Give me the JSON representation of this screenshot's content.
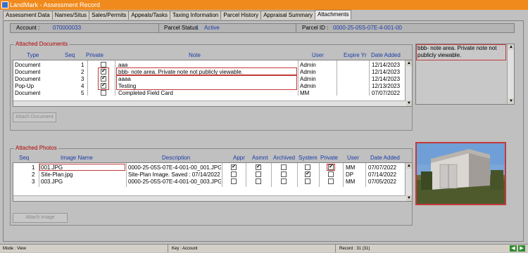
{
  "window": {
    "title": "LandMark - Assessment Record"
  },
  "tabs": [
    "Assessment Data",
    "Names/Situs",
    "Sales/Permits",
    "Appeals/Tasks",
    "Taxing Information",
    "Parcel History",
    "Appraisal Summary",
    "Attachments"
  ],
  "info": {
    "account_label": "Account :",
    "account_value": "070000033",
    "status_label": "Parcel Status",
    "status_num": "1",
    "status_value": "Active",
    "parcel_label": "Parcel ID :",
    "parcel_value": "0000-25-05S-07E-4-001-00"
  },
  "documents": {
    "title": "Attached Documents",
    "headers": {
      "type": "Type",
      "seq": "Seq",
      "private": "Private",
      "note": "Note",
      "user": "User",
      "expire": "Expire Yr",
      "date": "Date Added"
    },
    "rows": [
      {
        "type": "Document",
        "seq": "1",
        "private": false,
        "note": "aaa",
        "user": "Admin",
        "expire": "",
        "date": "12/14/2023"
      },
      {
        "type": "Document",
        "seq": "2",
        "private": true,
        "note": "bbb- note area. Private note not publicly viewable.",
        "user": "Admin",
        "expire": "",
        "date": "12/14/2023"
      },
      {
        "type": "Document",
        "seq": "3",
        "private": true,
        "note": "aaaa",
        "user": "Admin",
        "expire": "",
        "date": "12/14/2023"
      },
      {
        "type": "Pop-Up",
        "seq": "4",
        "private": true,
        "note": "Testing",
        "user": "Admin",
        "expire": "",
        "date": "12/13/2023"
      },
      {
        "type": "Document",
        "seq": "5",
        "private": false,
        "note": "Completed Field Card",
        "user": "MM",
        "expire": "",
        "date": "07/07/2022"
      }
    ],
    "attach_button": "Attach Document",
    "note_preview": "bbb- note area. Private note not publicly viewable."
  },
  "photos": {
    "title": "Attached Photos",
    "headers": {
      "seq": "Seq",
      "name": "Image Name",
      "desc": "Description",
      "appr": "Appr",
      "asmnt": "Asmnt",
      "archived": "Archived",
      "system": "System",
      "private": "Private",
      "user": "User",
      "date": "Date Added"
    },
    "rows": [
      {
        "seq": "1",
        "name": "001.JPG",
        "desc": "0000-25-05S-07E-4-001-00_001.JPG",
        "appr": true,
        "asmnt": true,
        "archived": false,
        "system": false,
        "private": true,
        "user": "MM",
        "date": "07/07/2022"
      },
      {
        "seq": "2",
        "name": "Site-Plan.jpg",
        "desc": "Site-Plan Image. Saved : 07/14/2022",
        "appr": false,
        "asmnt": false,
        "archived": false,
        "system": true,
        "private": false,
        "user": "DP",
        "date": "07/14/2022"
      },
      {
        "seq": "3",
        "name": "003.JPG",
        "desc": "0000-25-05S-07E-4-001-00_003.JPG",
        "appr": false,
        "asmnt": false,
        "archived": false,
        "system": false,
        "private": false,
        "user": "MM",
        "date": "07/05/2022"
      }
    ],
    "attach_button": "Attach Image"
  },
  "status": {
    "mode": "Mode : View",
    "key": "Key : Account",
    "record": "Record : 31 (31)"
  },
  "colors": {
    "title_bar": "#f08a1c",
    "highlight": "#c23a3a",
    "label_blue": "#1a3aa8"
  }
}
